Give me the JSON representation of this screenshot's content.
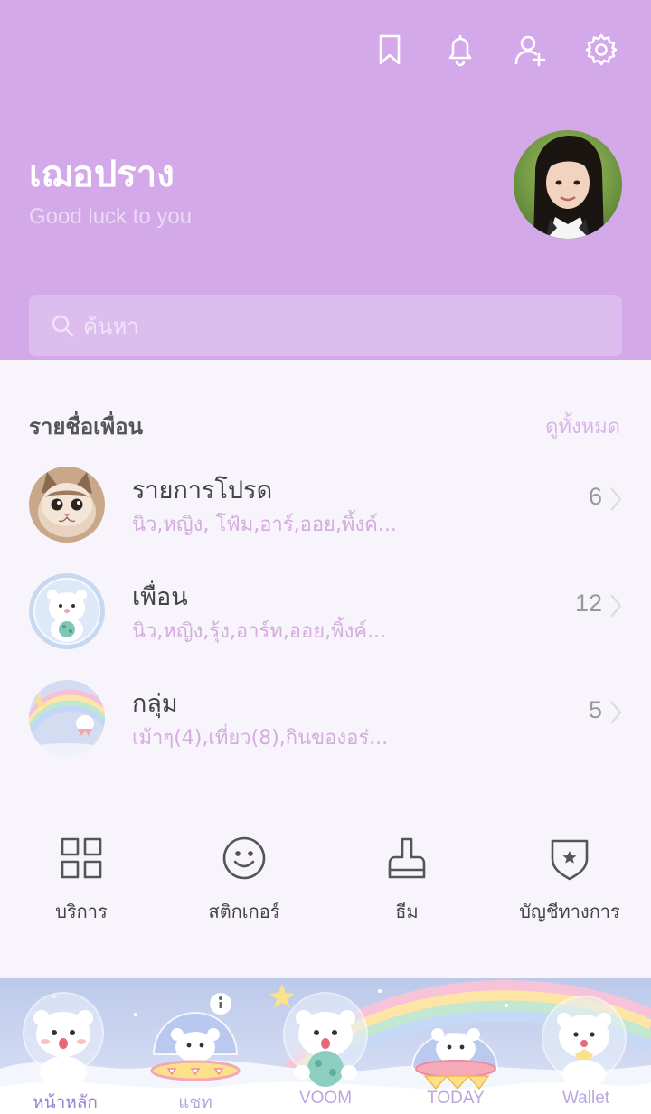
{
  "header": {
    "icons": [
      "bookmark-icon",
      "bell-icon",
      "add-friend-icon",
      "gear-icon"
    ],
    "name": "เฌอปราง",
    "status": "Good luck to you"
  },
  "search": {
    "placeholder": "ค้นหา"
  },
  "friends_section": {
    "title": "รายชื่อเพื่อน",
    "see_all": "ดูทั้งหมด",
    "items": [
      {
        "label": "รายการโปรด",
        "sub": "นิว,หญิง, โฟ้ม,อาร์,ออย,พิ้งค์...",
        "count": "6"
      },
      {
        "label": "เพื่อน",
        "sub": "นิว,หญิง,รุ้ง,อาร์ท,ออย,พิ้งค์...",
        "count": "12"
      },
      {
        "label": "กลุ่ม",
        "sub": "เม้าๆ(4),เที่ยว(8),กินของอร่...",
        "count": "5"
      }
    ]
  },
  "menu": {
    "items": [
      {
        "label": "บริการ",
        "icon": "grid-icon"
      },
      {
        "label": "สติกเกอร์",
        "icon": "smiley-icon"
      },
      {
        "label": "ธีม",
        "icon": "brush-icon"
      },
      {
        "label": "บัญชีทางการ",
        "icon": "shield-star-icon"
      }
    ]
  },
  "tabs": {
    "items": [
      {
        "label": "หน้าหลัก",
        "active": true
      },
      {
        "label": "แชท",
        "active": false
      },
      {
        "label": "VOOM",
        "active": false
      },
      {
        "label": "TODAY",
        "active": false
      },
      {
        "label": "Wallet",
        "active": false
      }
    ]
  },
  "colors": {
    "header_bg": "#d4a9e9",
    "page_bg": "#f8f4fc",
    "sub_text": "#d4acdd",
    "tab_text": "#b9a8dc"
  }
}
